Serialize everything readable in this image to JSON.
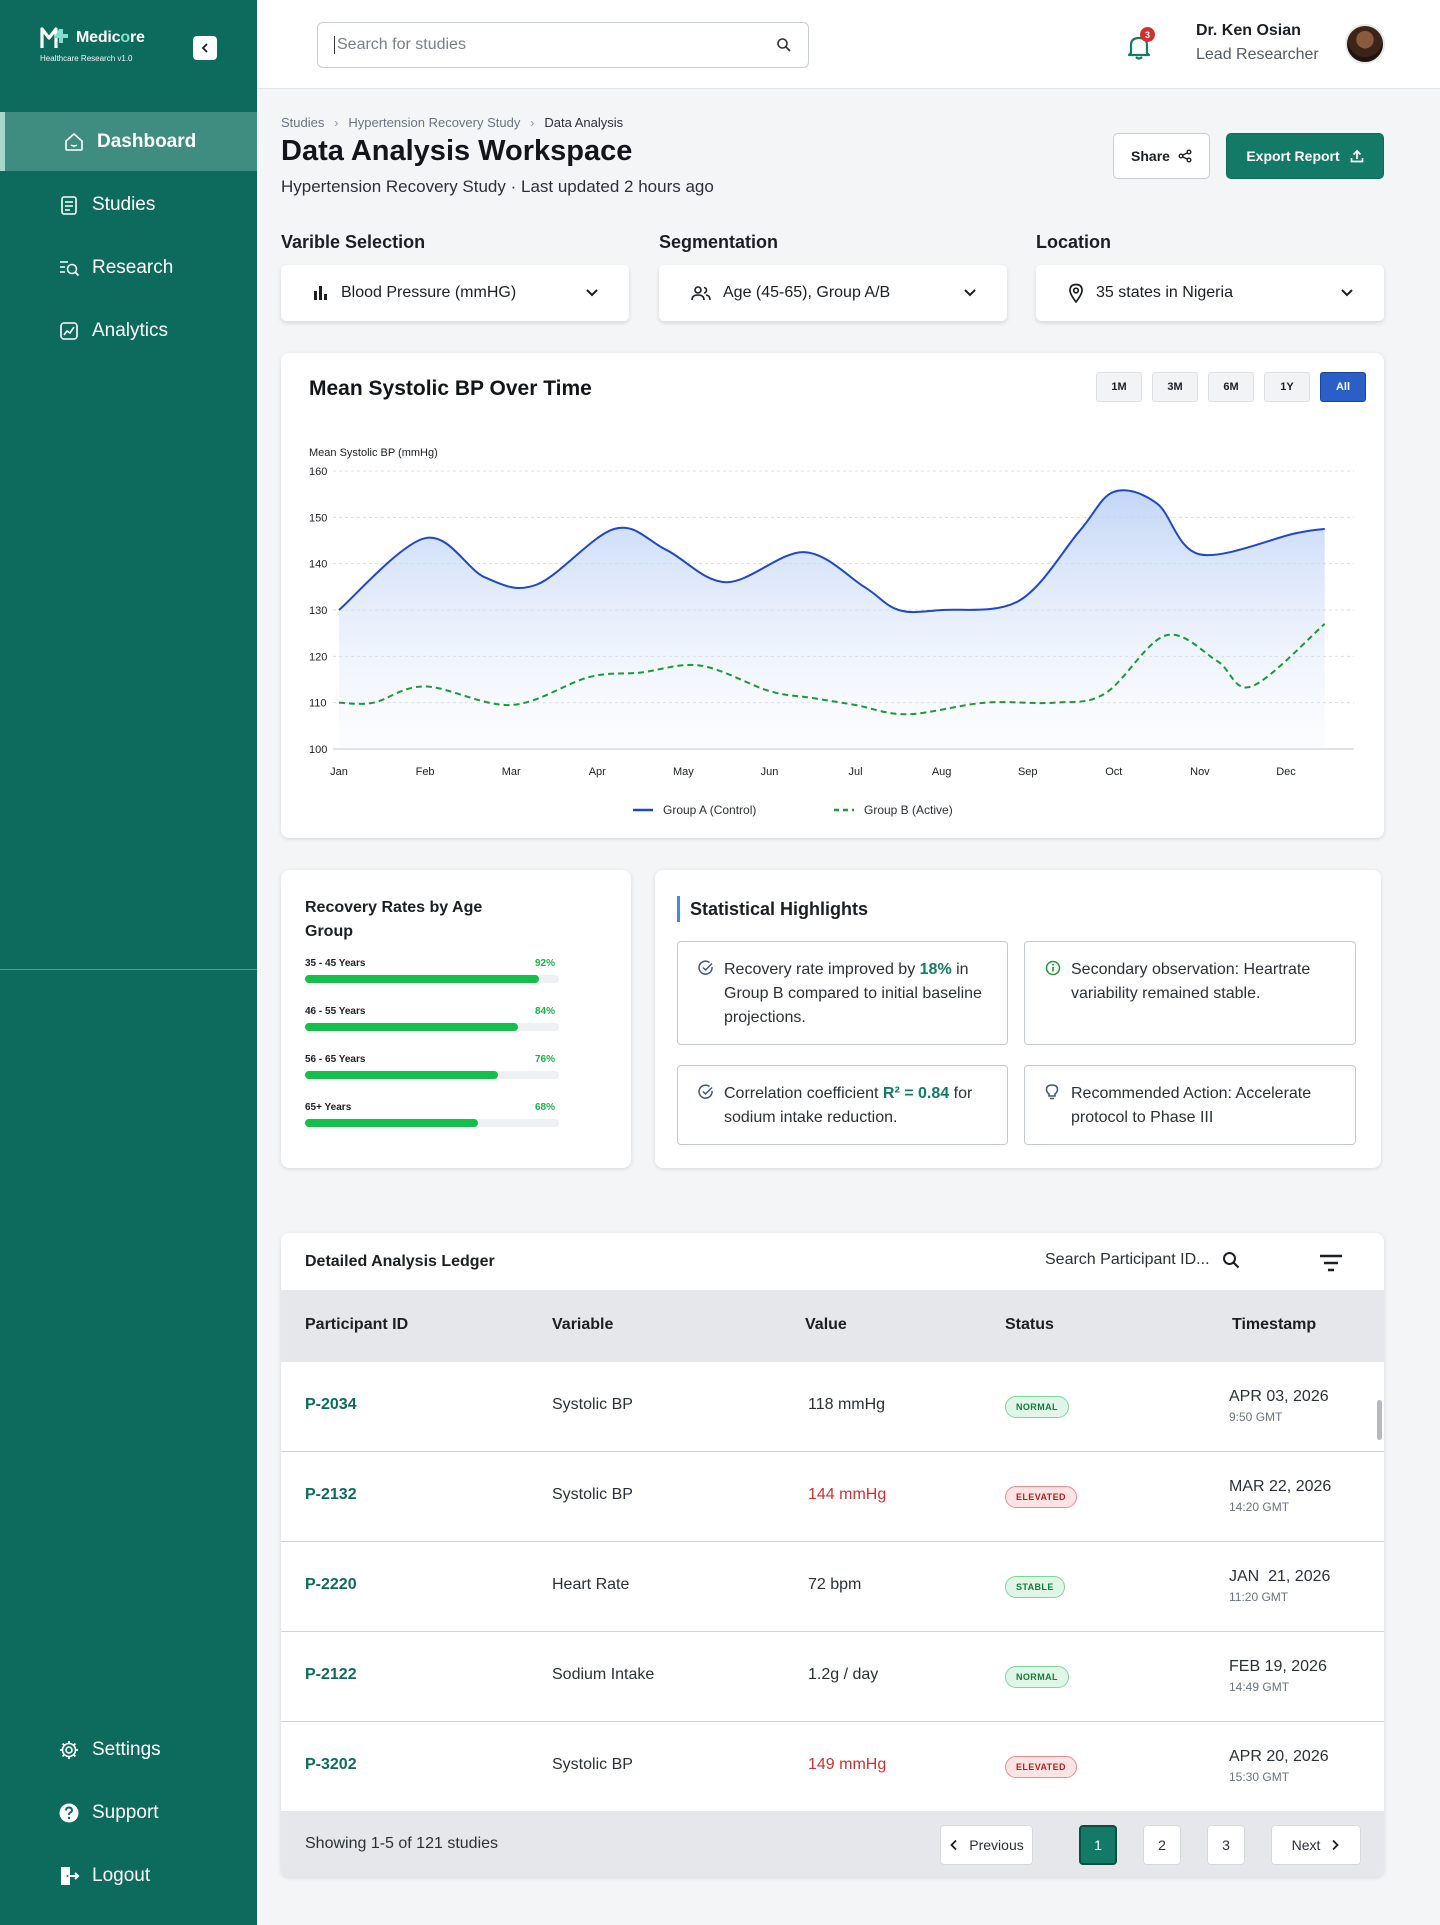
{
  "brand": {
    "name_a": "Medic",
    "name_b": "o",
    "name_c": "re",
    "subtitle": "Healthcare Research v1.0"
  },
  "sidebar": {
    "items": [
      {
        "label": "Dashboard",
        "icon": "home-icon",
        "active": true
      },
      {
        "label": "Studies",
        "icon": "document-icon"
      },
      {
        "label": "Research",
        "icon": "search-list-icon"
      },
      {
        "label": "Analytics",
        "icon": "analytics-icon"
      }
    ],
    "bottom_items": [
      {
        "label": "Settings",
        "icon": "gear-icon"
      },
      {
        "label": "Support",
        "icon": "help-icon"
      },
      {
        "label": "Logout",
        "icon": "logout-icon"
      }
    ]
  },
  "topbar": {
    "search_placeholder": "Search for studies",
    "notification_count": "3",
    "user_name": "Dr. Ken Osian",
    "user_role": "Lead Researcher"
  },
  "breadcrumbs": [
    "Studies",
    "Hypertension Recovery Study",
    "Data Analysis"
  ],
  "header": {
    "title": "Data Analysis Workspace",
    "subtitle": "Hypertension Recovery Study · Last updated 2 hours ago",
    "share_label": "Share",
    "export_label": "Export Report"
  },
  "filters": {
    "variable": {
      "label": "Varible Selection",
      "value": "Blood Pressure (mmHG)"
    },
    "segmentation": {
      "label": "Segmentation",
      "value": "Age (45-65), Group A/B"
    },
    "location": {
      "label": "Location",
      "value": "35 states in Nigeria"
    }
  },
  "chart_ranges": [
    "1M",
    "3M",
    "6M",
    "1Y",
    "All"
  ],
  "chart_active_range": "All",
  "chart_data": {
    "type": "line",
    "title": "Mean Systolic BP Over Time",
    "ylabel": "Mean Systolic BP (mmHg)",
    "xlabel": "",
    "categories": [
      "Jan",
      "Feb",
      "Mar",
      "Apr",
      "May",
      "Jun",
      "Jul",
      "Aug",
      "Sep",
      "Oct",
      "Nov",
      "Dec"
    ],
    "ylim": [
      100,
      160
    ],
    "yticks": [
      100,
      110,
      120,
      130,
      140,
      150,
      160
    ],
    "grid": true,
    "legend_position": "bottom-center",
    "series": [
      {
        "name": "Group A (Control)",
        "color": "#1f47c9",
        "style": "solid",
        "area": true,
        "x": [
          0,
          1,
          1.7,
          2.3,
          3.2,
          3.8,
          4.5,
          5.4,
          6.1,
          6.5,
          7.0,
          7.9,
          8.6,
          9.0,
          9.5,
          10.0,
          11.1,
          11.45
        ],
        "values": [
          130,
          145.5,
          137,
          135.5,
          147.5,
          143,
          136,
          142.5,
          135,
          130,
          130,
          132,
          147,
          155.5,
          153,
          142,
          146.5,
          147.5
        ]
      },
      {
        "name": "Group B (Active)",
        "color": "#1e9a32",
        "style": "dashed",
        "area": false,
        "x": [
          0,
          0.4,
          1.0,
          2.0,
          2.9,
          3.5,
          4.2,
          5.0,
          5.5,
          6.0,
          6.6,
          7.5,
          8.3,
          8.9,
          9.6,
          10.2,
          10.6,
          11.45
        ],
        "values": [
          110,
          110,
          113.5,
          109.5,
          115.5,
          116.5,
          118,
          112.5,
          111,
          109.5,
          107.5,
          110,
          110,
          112,
          124.5,
          119,
          113.5,
          127
        ]
      }
    ]
  },
  "age_groups": {
    "title": "Recovery Rates by Age Group",
    "rows": [
      {
        "label": "35 - 45 Years",
        "pct_label": "92%",
        "value": 0.92
      },
      {
        "label": "46 - 55 Years",
        "pct_label": "84%",
        "value": 0.84
      },
      {
        "label": "56 - 65 Years",
        "pct_label": "76%",
        "value": 0.76
      },
      {
        "label": "65+ Years",
        "pct_label": "68%",
        "value": 0.68
      }
    ]
  },
  "stats": {
    "title": "Statistical Highlights",
    "box1": {
      "a": "Recovery rate improved by ",
      "b": "18%",
      "c": " in Group B compared to initial baseline projections."
    },
    "box2": {
      "a": "Secondary observation: Heartrate variability remained stable."
    },
    "box3": {
      "a": "Correlation coefficient ",
      "b": "R² = 0.84",
      "c": " for sodium intake reduction."
    },
    "box4": {
      "a": "Recommended Action: Accelerate protocol to Phase III"
    }
  },
  "ledger": {
    "title": "Detailed Analysis Ledger",
    "search_placeholder": "Search Participant ID...",
    "columns": [
      "Participant ID",
      "Variable",
      "Value",
      "Status",
      "Timestamp"
    ],
    "rows": [
      {
        "id": "P-2034",
        "variable": "Systolic BP",
        "value": "118 mmHg",
        "flag": "",
        "status": "NORMAL",
        "status_type": "normal",
        "date": "APR 03, 2026",
        "time": "9:50 GMT"
      },
      {
        "id": "P-2132",
        "variable": "Systolic BP",
        "value": "144 mmHg",
        "flag": "red",
        "status": "ELEVATED",
        "status_type": "elevated",
        "date": "MAR 22, 2026",
        "time": "14:20 GMT"
      },
      {
        "id": "P-2220",
        "variable": "Heart Rate",
        "value": "72 bpm",
        "flag": "",
        "status": "STABLE",
        "status_type": "stable",
        "date": "JAN  21, 2026",
        "time": "11:20 GMT"
      },
      {
        "id": "P-2122",
        "variable": "Sodium Intake",
        "value": "1.2g / day",
        "flag": "",
        "status": "NORMAL",
        "status_type": "normal",
        "date": "FEB 19, 2026",
        "time": "14:49 GMT"
      },
      {
        "id": "P-3202",
        "variable": "Systolic BP",
        "value": "149 mmHg",
        "flag": "red",
        "status": "ELEVATED",
        "status_type": "elevated",
        "date": "APR 20, 2026",
        "time": "15:30 GMT"
      }
    ],
    "footer_text": "Showing 1-5 of 121 studies",
    "prev_label": "Previous",
    "next_label": "Next",
    "pages": [
      "1",
      "2",
      "3"
    ],
    "current_page": "1"
  }
}
